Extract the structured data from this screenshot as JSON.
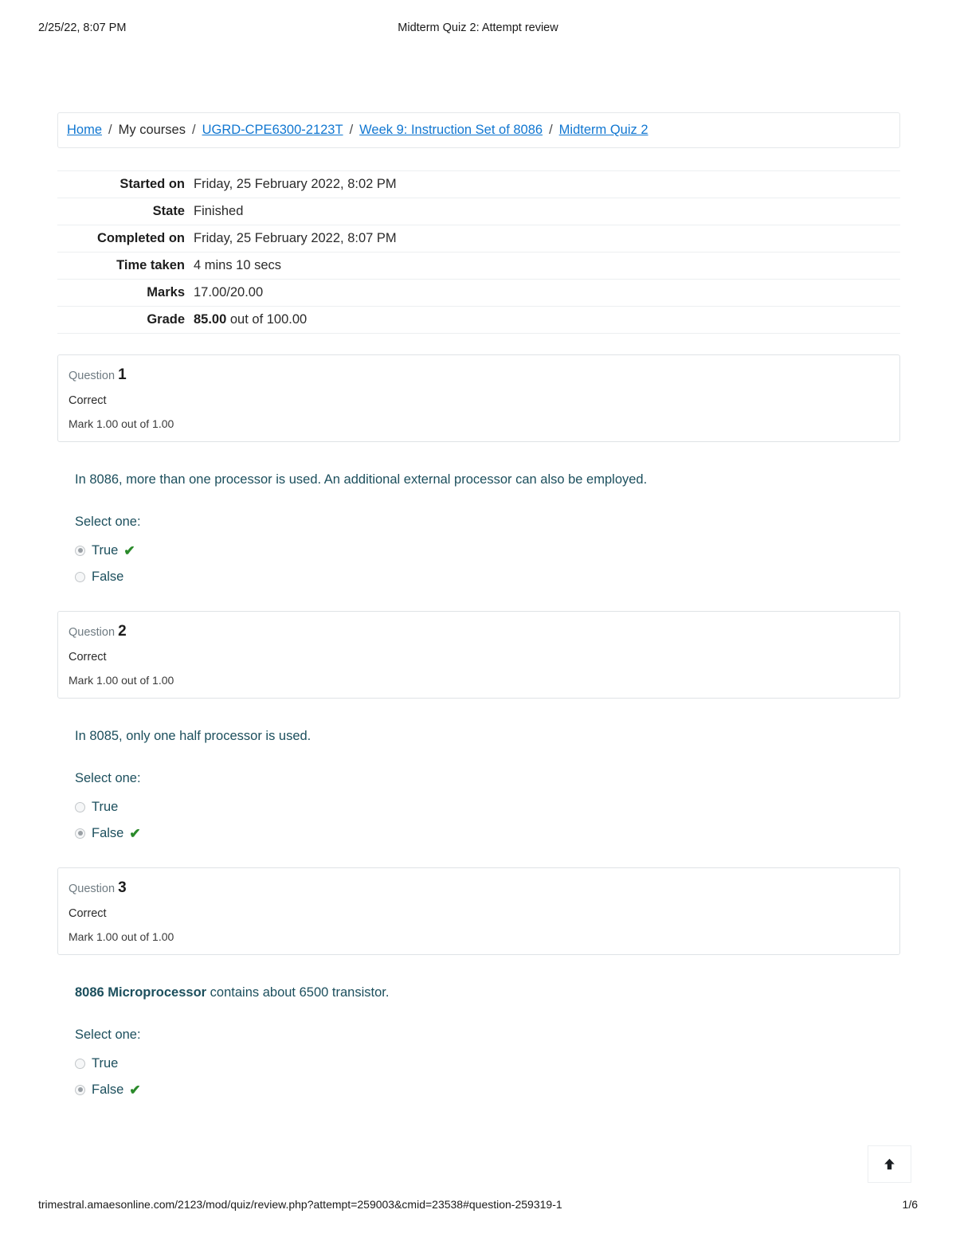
{
  "print_header": {
    "left": "2/25/22, 8:07 PM",
    "center": "Midterm Quiz 2: Attempt review"
  },
  "breadcrumb": {
    "separator": "/",
    "items": [
      {
        "label": "Home",
        "link": true
      },
      {
        "label": "My courses",
        "link": false
      },
      {
        "label": "UGRD-CPE6300-2123T",
        "link": true
      },
      {
        "label": "Week 9: Instruction Set of 8086",
        "link": true
      },
      {
        "label": "Midterm Quiz 2",
        "link": true
      }
    ]
  },
  "summary": {
    "rows": [
      {
        "label": "Started on",
        "value": "Friday, 25 February 2022, 8:02 PM"
      },
      {
        "label": "State",
        "value": "Finished"
      },
      {
        "label": "Completed on",
        "value": "Friday, 25 February 2022, 8:07 PM"
      },
      {
        "label": "Time taken",
        "value": "4 mins 10 secs"
      },
      {
        "label": "Marks",
        "value": "17.00/20.00"
      },
      {
        "label": "Grade",
        "value_bold": "85.00",
        "value_rest": " out of 100.00"
      }
    ]
  },
  "questions": [
    {
      "question_word": "Question",
      "number": "1",
      "state": "Correct",
      "mark": "Mark 1.00 out of 1.00",
      "text_prefix": "",
      "text": "In 8086, more than one processor is used. An additional external processor can also be employed.",
      "select_label": "Select one:",
      "options": [
        {
          "label": "True",
          "selected": true,
          "correct": true
        },
        {
          "label": "False",
          "selected": false,
          "correct": false
        }
      ]
    },
    {
      "question_word": "Question",
      "number": "2",
      "state": "Correct",
      "mark": "Mark 1.00 out of 1.00",
      "text_prefix": "",
      "text": "In 8085, only one half processor is used.",
      "select_label": "Select one:",
      "options": [
        {
          "label": "True",
          "selected": false,
          "correct": false
        },
        {
          "label": "False",
          "selected": true,
          "correct": true
        }
      ]
    },
    {
      "question_word": "Question",
      "number": "3",
      "state": "Correct",
      "mark": "Mark 1.00 out of 1.00",
      "text_prefix": "8086 Microprocessor",
      "text": " contains about 6500 transistor.",
      "select_label": "Select one:",
      "options": [
        {
          "label": "True",
          "selected": false,
          "correct": false
        },
        {
          "label": "False",
          "selected": true,
          "correct": true
        }
      ]
    }
  ],
  "icons": {
    "correct_tick": "✔",
    "back_to_top": "arrow-up"
  },
  "print_footer": {
    "url": "trimestral.amaesonline.com/2123/mod/quiz/review.php?attempt=259003&cmid=23538#question-259319-1",
    "page": "1/6"
  },
  "colors": {
    "link": "#1177d1",
    "question_text": "#1c4f5d",
    "correct_green": "#2a8a2a",
    "border": "#dfe3e6"
  }
}
